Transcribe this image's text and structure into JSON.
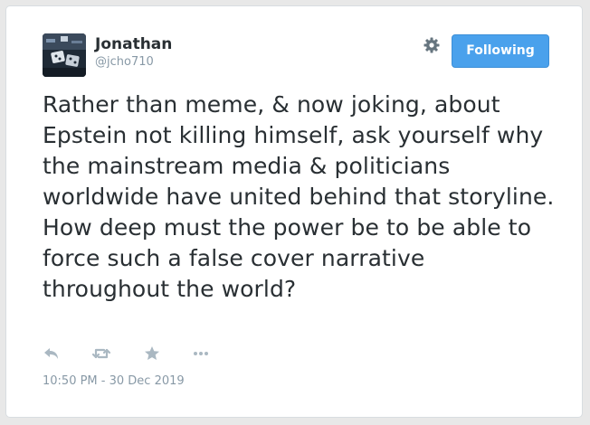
{
  "user": {
    "name": "Jonathan",
    "handle": "@jcho710"
  },
  "header": {
    "follow_label": "Following",
    "settings_icon": "gear-icon"
  },
  "tweet": {
    "text": "Rather than meme, & now joking, about Epstein not killing himself, ask yourself why the mainstream media & politicians worldwide have united behind that storyline. How deep must the power be to be able to force such a false cover narrative throughout the world?",
    "timestamp": "10:50 PM - 30 Dec 2019"
  },
  "actions": {
    "icons": [
      "reply-icon",
      "retweet-icon",
      "like-star-icon",
      "more-dots-icon"
    ]
  },
  "colors": {
    "accent": "#4aa1ec",
    "text": "#292f33",
    "muted": "#8899a6",
    "icon": "#aab8c2"
  }
}
